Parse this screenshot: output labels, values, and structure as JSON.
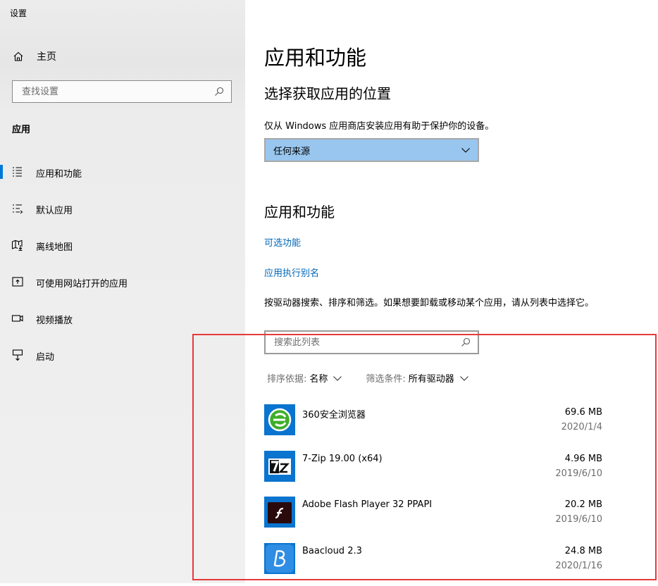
{
  "window": {
    "title": "设置"
  },
  "sidebar": {
    "home_label": "主页",
    "search_placeholder": "查找设置",
    "section_title": "应用",
    "items": [
      {
        "label": "应用和功能",
        "icon": "apps-features-icon",
        "selected": true
      },
      {
        "label": "默认应用",
        "icon": "default-apps-icon",
        "selected": false
      },
      {
        "label": "离线地图",
        "icon": "offline-maps-icon",
        "selected": false
      },
      {
        "label": "可使用网站打开的应用",
        "icon": "apps-for-websites-icon",
        "selected": false
      },
      {
        "label": "视频播放",
        "icon": "video-playback-icon",
        "selected": false
      },
      {
        "label": "启动",
        "icon": "startup-icon",
        "selected": false
      }
    ]
  },
  "main": {
    "title": "应用和功能",
    "location_heading": "选择获取应用的位置",
    "location_desc": "仅从 Windows 应用商店安装应用有助于保护你的设备。",
    "location_select_value": "任何来源",
    "apps_heading": "应用和功能",
    "optional_features_link": "可选功能",
    "app_alias_link": "应用执行别名",
    "list_desc": "按驱动器搜索、排序和筛选。如果想要卸载或移动某个应用，请从列表中选择它。",
    "list_search_placeholder": "搜索此列表",
    "sort_label": "排序依据:",
    "sort_value": "名称",
    "filter_label": "筛选条件:",
    "filter_value": "所有驱动器",
    "apps": [
      {
        "name": "360安全浏览器",
        "size": "69.6 MB",
        "date": "2020/1/4",
        "icon": "360-browser-icon"
      },
      {
        "name": "7-Zip 19.00 (x64)",
        "size": "4.96 MB",
        "date": "2019/6/10",
        "icon": "7zip-icon"
      },
      {
        "name": "Adobe Flash Player 32 PPAPI",
        "size": "20.2 MB",
        "date": "2019/6/10",
        "icon": "flash-player-icon"
      },
      {
        "name": "Baacloud 2.3",
        "size": "24.8 MB",
        "date": "2020/1/16",
        "icon": "baacloud-icon"
      }
    ]
  },
  "colors": {
    "accent": "#0078d7",
    "link": "#0067b8",
    "select_bg": "#99c6ee",
    "highlight_box": "#e5393b"
  }
}
